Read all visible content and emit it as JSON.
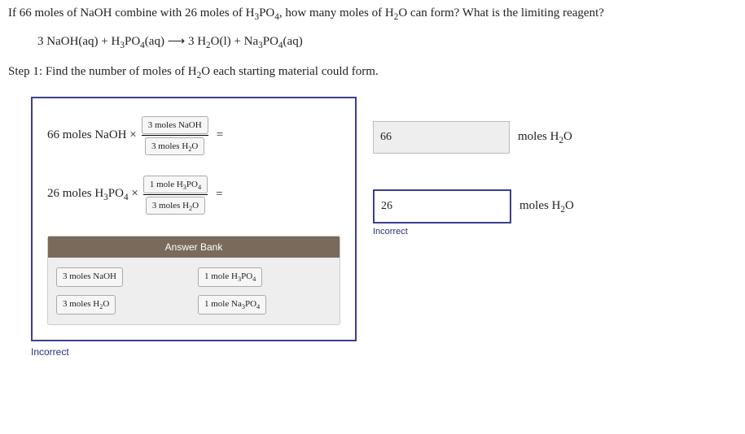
{
  "question": {
    "line1_a": "If 66 moles of NaOH combine with 26 moles of H",
    "line1_b": "PO",
    "line1_c": ", how many moles of H",
    "line1_d": "O can form? What is the limiting reagent?"
  },
  "equation": {
    "p1": "3 NaOH(aq) + H",
    "p2": "PO",
    "p3": "(aq)  ⟶  3 H",
    "p4": "O(l) + Na",
    "p5": "PO",
    "p6": "(aq)"
  },
  "step_a": "Step 1: Find the number of moles of H",
  "step_b": "O each starting material could form.",
  "calc1": {
    "label": "66 moles NaOH ×",
    "top": "3 moles NaOH",
    "bot_a": "3 moles H",
    "bot_b": "O",
    "eq": "="
  },
  "calc2": {
    "label_a": "26 moles H",
    "label_b": "PO",
    "label_c": " ×",
    "top_a": "1 mole H",
    "top_b": "PO",
    "bot_a": "3 moles H",
    "bot_b": "O",
    "eq": "="
  },
  "bank": {
    "header": "Answer Bank",
    "items": {
      "i1": "3 moles NaOH",
      "i2_a": "1 mole H",
      "i2_b": "PO",
      "i3_a": "3 moles H",
      "i3_b": "O",
      "i4_a": "1 mole Na",
      "i4_b": "PO"
    }
  },
  "ans1": {
    "value": "66",
    "label_a": "moles H",
    "label_b": "O"
  },
  "ans2": {
    "value": "26",
    "label_a": "moles H",
    "label_b": "O",
    "feedback": "Incorrect"
  },
  "bottom_feedback": "Incorrect"
}
